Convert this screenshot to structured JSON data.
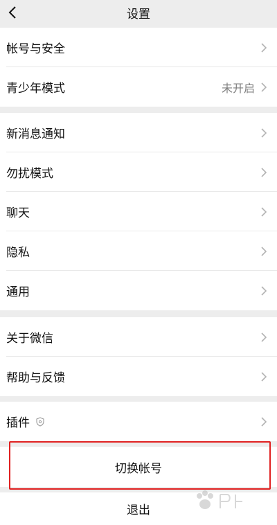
{
  "nav": {
    "title": "设置"
  },
  "groups": [
    {
      "items": [
        {
          "label": "帐号与安全",
          "value": ""
        },
        {
          "label": "青少年模式",
          "value": "未开启"
        }
      ]
    },
    {
      "items": [
        {
          "label": "新消息通知",
          "value": ""
        },
        {
          "label": "勿扰模式",
          "value": ""
        },
        {
          "label": "聊天",
          "value": ""
        },
        {
          "label": "隐私",
          "value": ""
        },
        {
          "label": "通用",
          "value": ""
        }
      ]
    },
    {
      "items": [
        {
          "label": "关于微信",
          "value": ""
        },
        {
          "label": "帮助与反馈",
          "value": ""
        }
      ]
    },
    {
      "items": [
        {
          "label": "插件",
          "value": ""
        }
      ]
    }
  ],
  "actions": {
    "switch_account": "切换帐号",
    "logout": "退出"
  },
  "icons": {
    "back": "chevron-left-icon",
    "chevron": "chevron-right-icon",
    "plugin_badge": "shield-icon"
  },
  "colors": {
    "background": "#ededed",
    "highlight": "#e02020",
    "secondary_text": "#7f7f7f"
  }
}
